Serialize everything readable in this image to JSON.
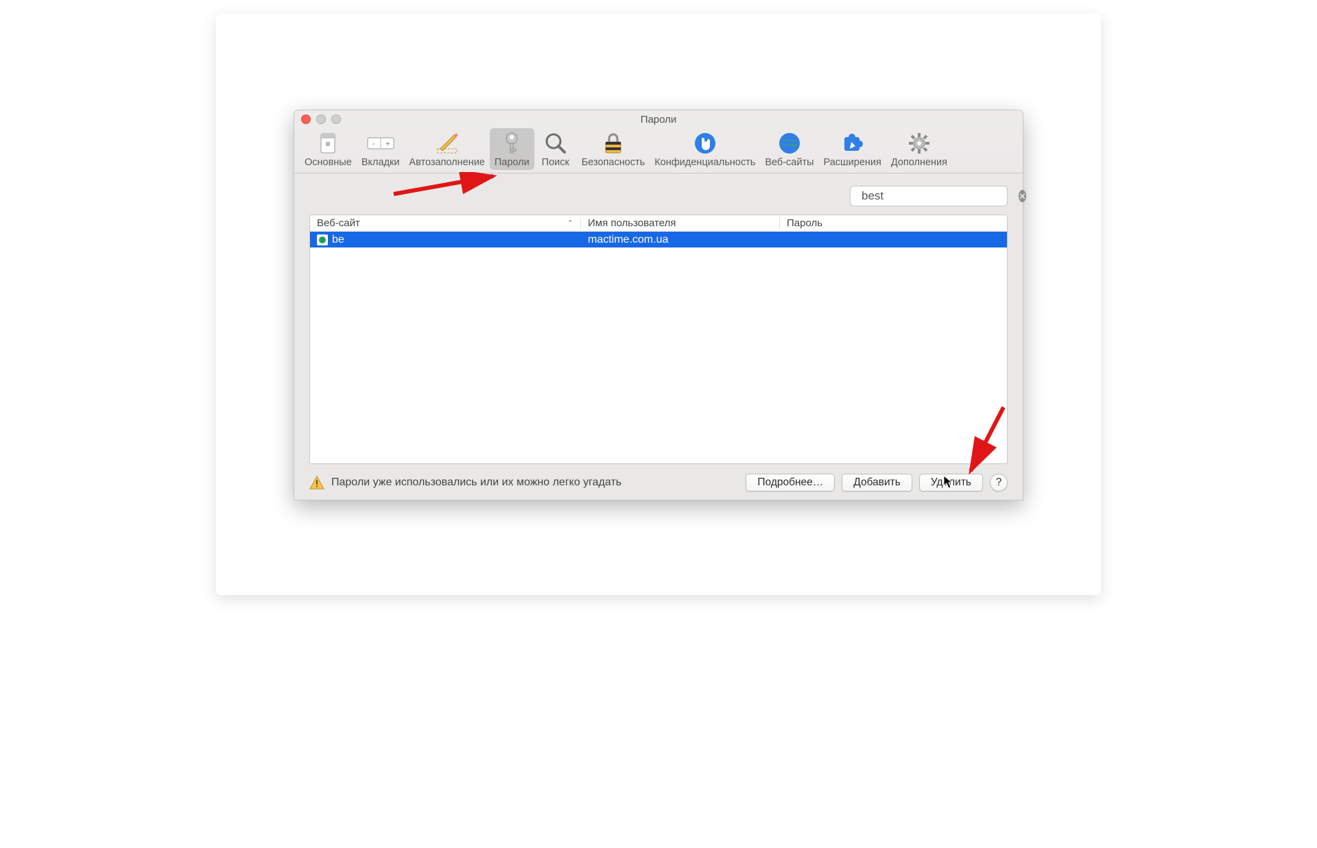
{
  "window": {
    "title": "Пароли"
  },
  "toolbar": {
    "items": [
      {
        "label": "Основные"
      },
      {
        "label": "Вкладки"
      },
      {
        "label": "Автозаполнение"
      },
      {
        "label": "Пароли"
      },
      {
        "label": "Поиск"
      },
      {
        "label": "Безопасность"
      },
      {
        "label": "Конфиденциальность"
      },
      {
        "label": "Веб-сайты"
      },
      {
        "label": "Расширения"
      },
      {
        "label": "Дополнения"
      }
    ],
    "active_index": 3
  },
  "search": {
    "value": "best"
  },
  "table": {
    "columns": {
      "website": "Веб-сайт",
      "username": "Имя пользователя",
      "password": "Пароль"
    },
    "rows": [
      {
        "website": "be",
        "username": "mactime.com.ua",
        "password": ""
      }
    ],
    "selected_index": 0
  },
  "footer": {
    "warning": "Пароли уже использовались или их можно легко угадать",
    "details": "Подробнее…",
    "add": "Добавить",
    "delete": "Удалить",
    "help": "?"
  }
}
